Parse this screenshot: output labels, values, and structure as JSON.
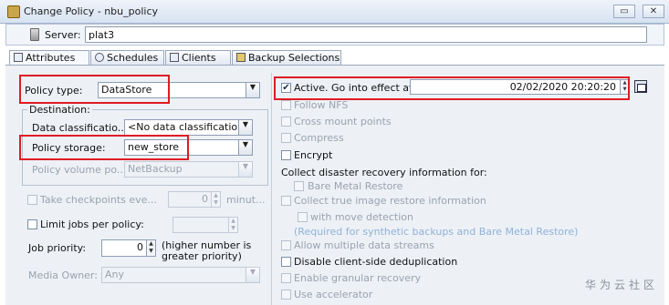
{
  "window": {
    "title": "Change Policy - nbu_policy",
    "minimize": "▭",
    "close": "✕"
  },
  "server": {
    "label": "Server:",
    "value": "plat3"
  },
  "tabs": [
    {
      "label": "Attributes"
    },
    {
      "label": "Schedules"
    },
    {
      "label": "Clients"
    },
    {
      "label": "Backup Selections"
    }
  ],
  "left": {
    "policy_type": {
      "label": "Policy type:",
      "value": "DataStore"
    },
    "destination": {
      "title": "Destination:",
      "data_classification": {
        "label": "Data classificatio...",
        "value": "<No data classificatio..."
      },
      "policy_storage": {
        "label": "Policy storage:",
        "value": "new_store"
      },
      "policy_volume_pool": {
        "label": "Policy volume po...",
        "value": "NetBackup"
      }
    },
    "take_checkpoints": {
      "label": "Take checkpoints eve...",
      "value": "0",
      "unit": "minut..."
    },
    "limit_jobs": {
      "label": "Limit jobs per policy:",
      "value": ""
    },
    "job_priority": {
      "label": "Job priority:",
      "value": "0",
      "hint": "(higher number is greater priority)"
    },
    "media_owner": {
      "label": "Media Owner:",
      "value": "Any"
    }
  },
  "right": {
    "active": {
      "label": "Active. Go into effect at:",
      "checked": true,
      "datetime": "02/02/2020 20:20:20"
    },
    "options": [
      {
        "label": "Follow NFS",
        "checked": false,
        "enabled": false
      },
      {
        "label": "Cross mount points",
        "checked": false,
        "enabled": false
      },
      {
        "label": "Compress",
        "checked": false,
        "enabled": false
      },
      {
        "label": "Encrypt",
        "checked": false,
        "enabled": true
      }
    ],
    "collect_disaster": "Collect disaster recovery information for:",
    "bare_metal": {
      "label": "Bare Metal Restore",
      "enabled": false
    },
    "true_image": {
      "label": "Collect true image restore information",
      "enabled": false
    },
    "move_detection": {
      "label": "with move detection",
      "enabled": false
    },
    "required_note": "(Required for synthetic backups and Bare Metal Restore)",
    "allow_multiple": {
      "label": "Allow multiple data streams",
      "enabled": false
    },
    "disable_dedup": {
      "label": "Disable client-side deduplication",
      "enabled": true
    },
    "granular": {
      "label": "Enable granular recovery",
      "enabled": false
    },
    "accelerator": {
      "label": "Use accelerator",
      "enabled": false
    }
  },
  "watermark": "华为云社区",
  "colors": {
    "highlight": "#e01b24",
    "disabled_text": "#9aa2ad",
    "link_note": "#8fb1d6"
  }
}
